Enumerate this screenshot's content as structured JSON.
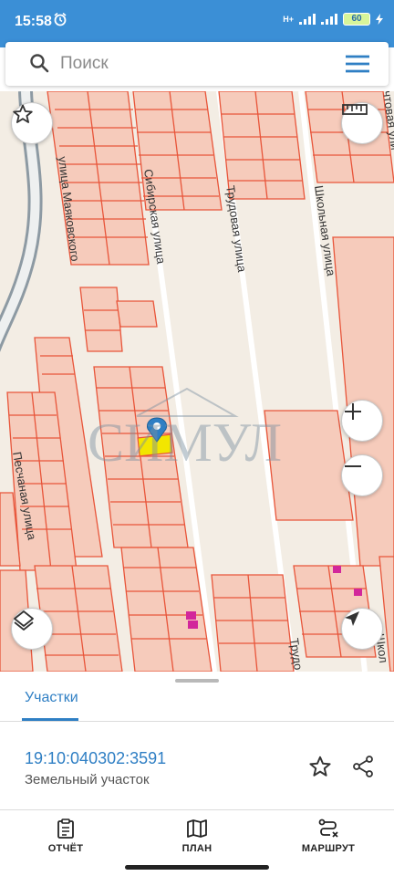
{
  "status": {
    "time": "15:58",
    "network": "H+",
    "battery": "60"
  },
  "search": {
    "placeholder": "Поиск",
    "value": ""
  },
  "map": {
    "streets": [
      "улица Маяковского",
      "Сибирская улица",
      "Трудовая улица",
      "Школьная улица",
      "Песчаная улица",
      "Трудо",
      "Школ",
      "чтовая ули"
    ],
    "watermark": "СИМУЛ",
    "colors": {
      "parcel_fill": "#f6cbbb",
      "parcel_stroke": "#e8553a",
      "background": "#f3ede4",
      "road": "#8d9aa3",
      "selected": "#f2e600",
      "marker": "#d2279b"
    }
  },
  "sheet": {
    "tab_label": "Участки",
    "parcel_id": "19:10:040302:3591",
    "parcel_type": "Земельный участок"
  },
  "bottom_nav": [
    {
      "label": "ОТЧЁТ",
      "icon": "report-icon"
    },
    {
      "label": "ПЛАН",
      "icon": "map-plan-icon"
    },
    {
      "label": "МАРШРУТ",
      "icon": "route-icon"
    }
  ]
}
